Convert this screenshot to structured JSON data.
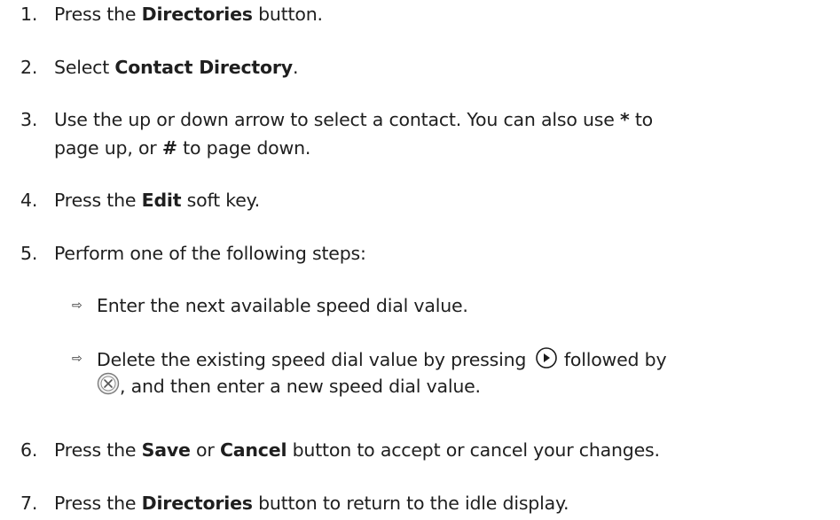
{
  "steps": [
    {
      "num": "1.",
      "pre": "Press the ",
      "bold": "Directories",
      "post": " button."
    },
    {
      "num": "2.",
      "pre": "Select ",
      "bold": "Contact Directory",
      "post": "."
    },
    {
      "num": "3.",
      "line1_pre": "Use the up or down arrow to select a contact. You can also use ",
      "line1_bold": "*",
      "line1_post": " to",
      "line2_pre": "page up, or ",
      "line2_bold": "#",
      "line2_post": " to page down."
    },
    {
      "num": "4.",
      "pre": "Press the ",
      "bold": "Edit",
      "post": " soft key."
    },
    {
      "num": "5.",
      "text": "Perform one of the following steps:"
    },
    {
      "num": "6.",
      "pre": "Press the ",
      "bold": "Save",
      "mid": " or ",
      "bold2": "Cancel",
      "post": " button to accept or cancel your changes."
    },
    {
      "num": "7.",
      "pre": "Press the ",
      "bold": "Directories",
      "post": " button to return to the idle display."
    }
  ],
  "substeps": [
    {
      "bullet": "⇨",
      "text": "Enter the next available speed dial value."
    },
    {
      "bullet": "⇨",
      "line1": "Delete the existing speed dial value by pressing ",
      "line1_after_icon": " followed by",
      "line2_after_icon": ", and then enter a new speed dial value."
    }
  ],
  "icons": {
    "first": "right-arrow-circle-icon",
    "second": "cancel-x-circle-icon"
  }
}
